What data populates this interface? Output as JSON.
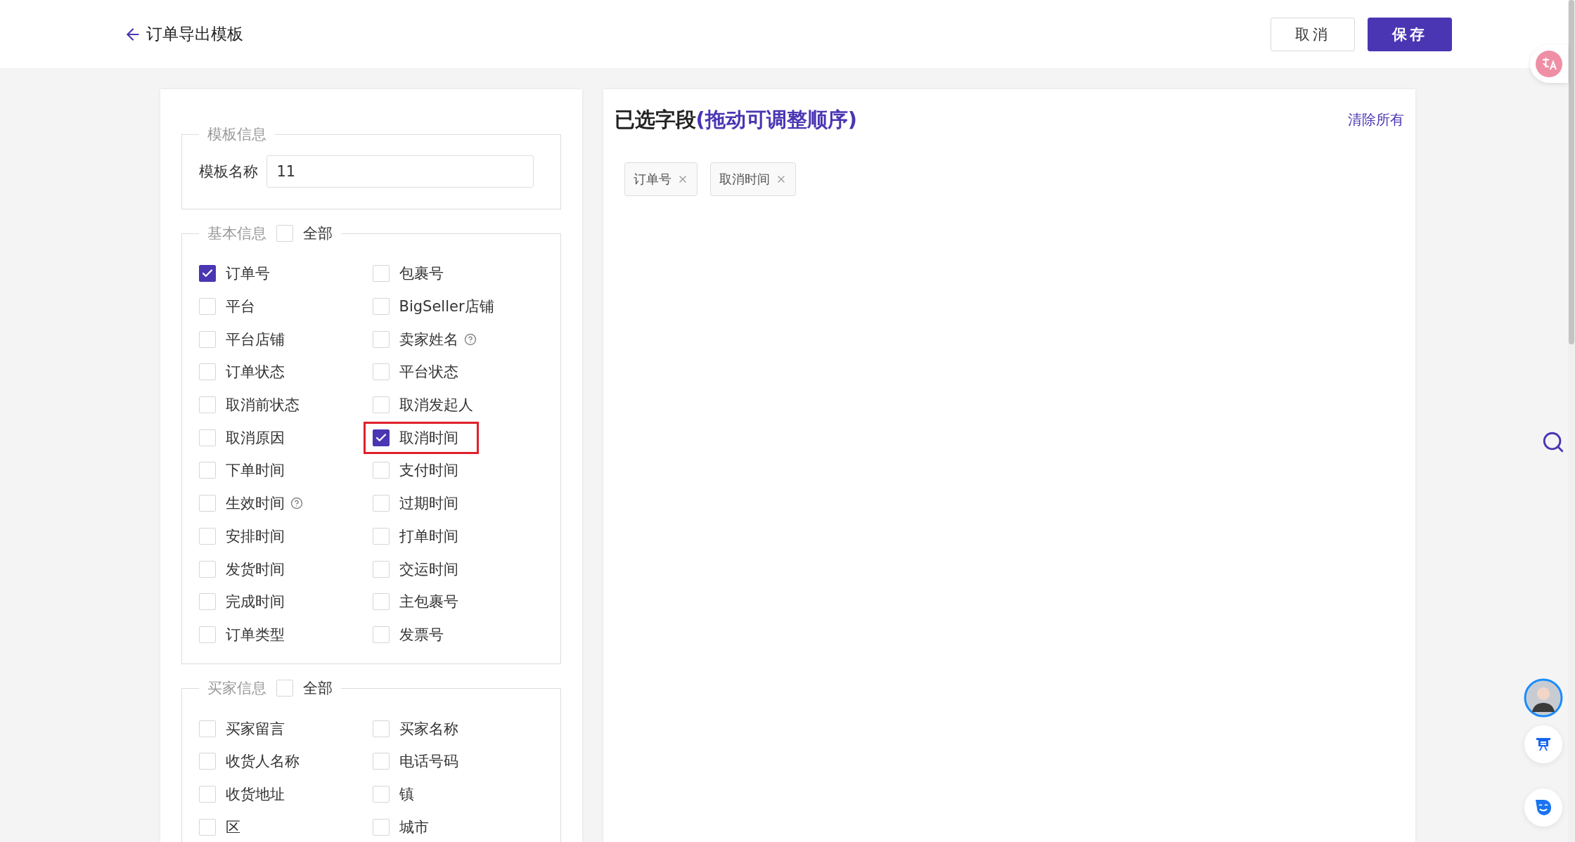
{
  "header": {
    "title": "订单导出模板",
    "buttons": [
      {
        "label": "取消",
        "kind": "secondary"
      },
      {
        "label": "保存",
        "kind": "primary"
      }
    ]
  },
  "template_info": {
    "legend": "模板信息",
    "name_label": "模板名称",
    "name_value": "11"
  },
  "sections": [
    {
      "legend": "基本信息",
      "all_label": "全部",
      "all_checked": false,
      "fields": [
        {
          "label": "订单号",
          "checked": true,
          "help": false,
          "highlighted": false
        },
        {
          "label": "包裹号",
          "checked": false,
          "help": false,
          "highlighted": false
        },
        {
          "label": "平台",
          "checked": false,
          "help": false,
          "highlighted": false
        },
        {
          "label": "BigSeller店铺",
          "checked": false,
          "help": false,
          "highlighted": false
        },
        {
          "label": "平台店铺",
          "checked": false,
          "help": false,
          "highlighted": false
        },
        {
          "label": "卖家姓名",
          "checked": false,
          "help": true,
          "highlighted": false
        },
        {
          "label": "订单状态",
          "checked": false,
          "help": false,
          "highlighted": false
        },
        {
          "label": "平台状态",
          "checked": false,
          "help": false,
          "highlighted": false
        },
        {
          "label": "取消前状态",
          "checked": false,
          "help": false,
          "highlighted": false
        },
        {
          "label": "取消发起人",
          "checked": false,
          "help": false,
          "highlighted": false
        },
        {
          "label": "取消原因",
          "checked": false,
          "help": false,
          "highlighted": false
        },
        {
          "label": "取消时间",
          "checked": true,
          "help": false,
          "highlighted": true
        },
        {
          "label": "下单时间",
          "checked": false,
          "help": false,
          "highlighted": false
        },
        {
          "label": "支付时间",
          "checked": false,
          "help": false,
          "highlighted": false
        },
        {
          "label": "生效时间",
          "checked": false,
          "help": true,
          "highlighted": false
        },
        {
          "label": "过期时间",
          "checked": false,
          "help": false,
          "highlighted": false
        },
        {
          "label": "安排时间",
          "checked": false,
          "help": false,
          "highlighted": false
        },
        {
          "label": "打单时间",
          "checked": false,
          "help": false,
          "highlighted": false
        },
        {
          "label": "发货时间",
          "checked": false,
          "help": false,
          "highlighted": false
        },
        {
          "label": "交运时间",
          "checked": false,
          "help": false,
          "highlighted": false
        },
        {
          "label": "完成时间",
          "checked": false,
          "help": false,
          "highlighted": false
        },
        {
          "label": "主包裹号",
          "checked": false,
          "help": false,
          "highlighted": false
        },
        {
          "label": "订单类型",
          "checked": false,
          "help": false,
          "highlighted": false
        },
        {
          "label": "发票号",
          "checked": false,
          "help": false,
          "highlighted": false
        }
      ]
    },
    {
      "legend": "买家信息",
      "all_label": "全部",
      "all_checked": false,
      "fields": [
        {
          "label": "买家留言",
          "checked": false,
          "help": false,
          "highlighted": false
        },
        {
          "label": "买家名称",
          "checked": false,
          "help": false,
          "highlighted": false
        },
        {
          "label": "收货人名称",
          "checked": false,
          "help": false,
          "highlighted": false
        },
        {
          "label": "电话号码",
          "checked": false,
          "help": false,
          "highlighted": false
        },
        {
          "label": "收货地址",
          "checked": false,
          "help": false,
          "highlighted": false
        },
        {
          "label": "镇",
          "checked": false,
          "help": false,
          "highlighted": false
        },
        {
          "label": "区",
          "checked": false,
          "help": false,
          "highlighted": false
        },
        {
          "label": "城市",
          "checked": false,
          "help": false,
          "highlighted": false
        }
      ]
    }
  ],
  "selected_panel": {
    "title": "已选字段",
    "title_hint": "(拖动可调整顺序)",
    "clear_label": "清除所有",
    "tags": [
      {
        "label": "订单号"
      },
      {
        "label": "取消时间"
      }
    ]
  }
}
